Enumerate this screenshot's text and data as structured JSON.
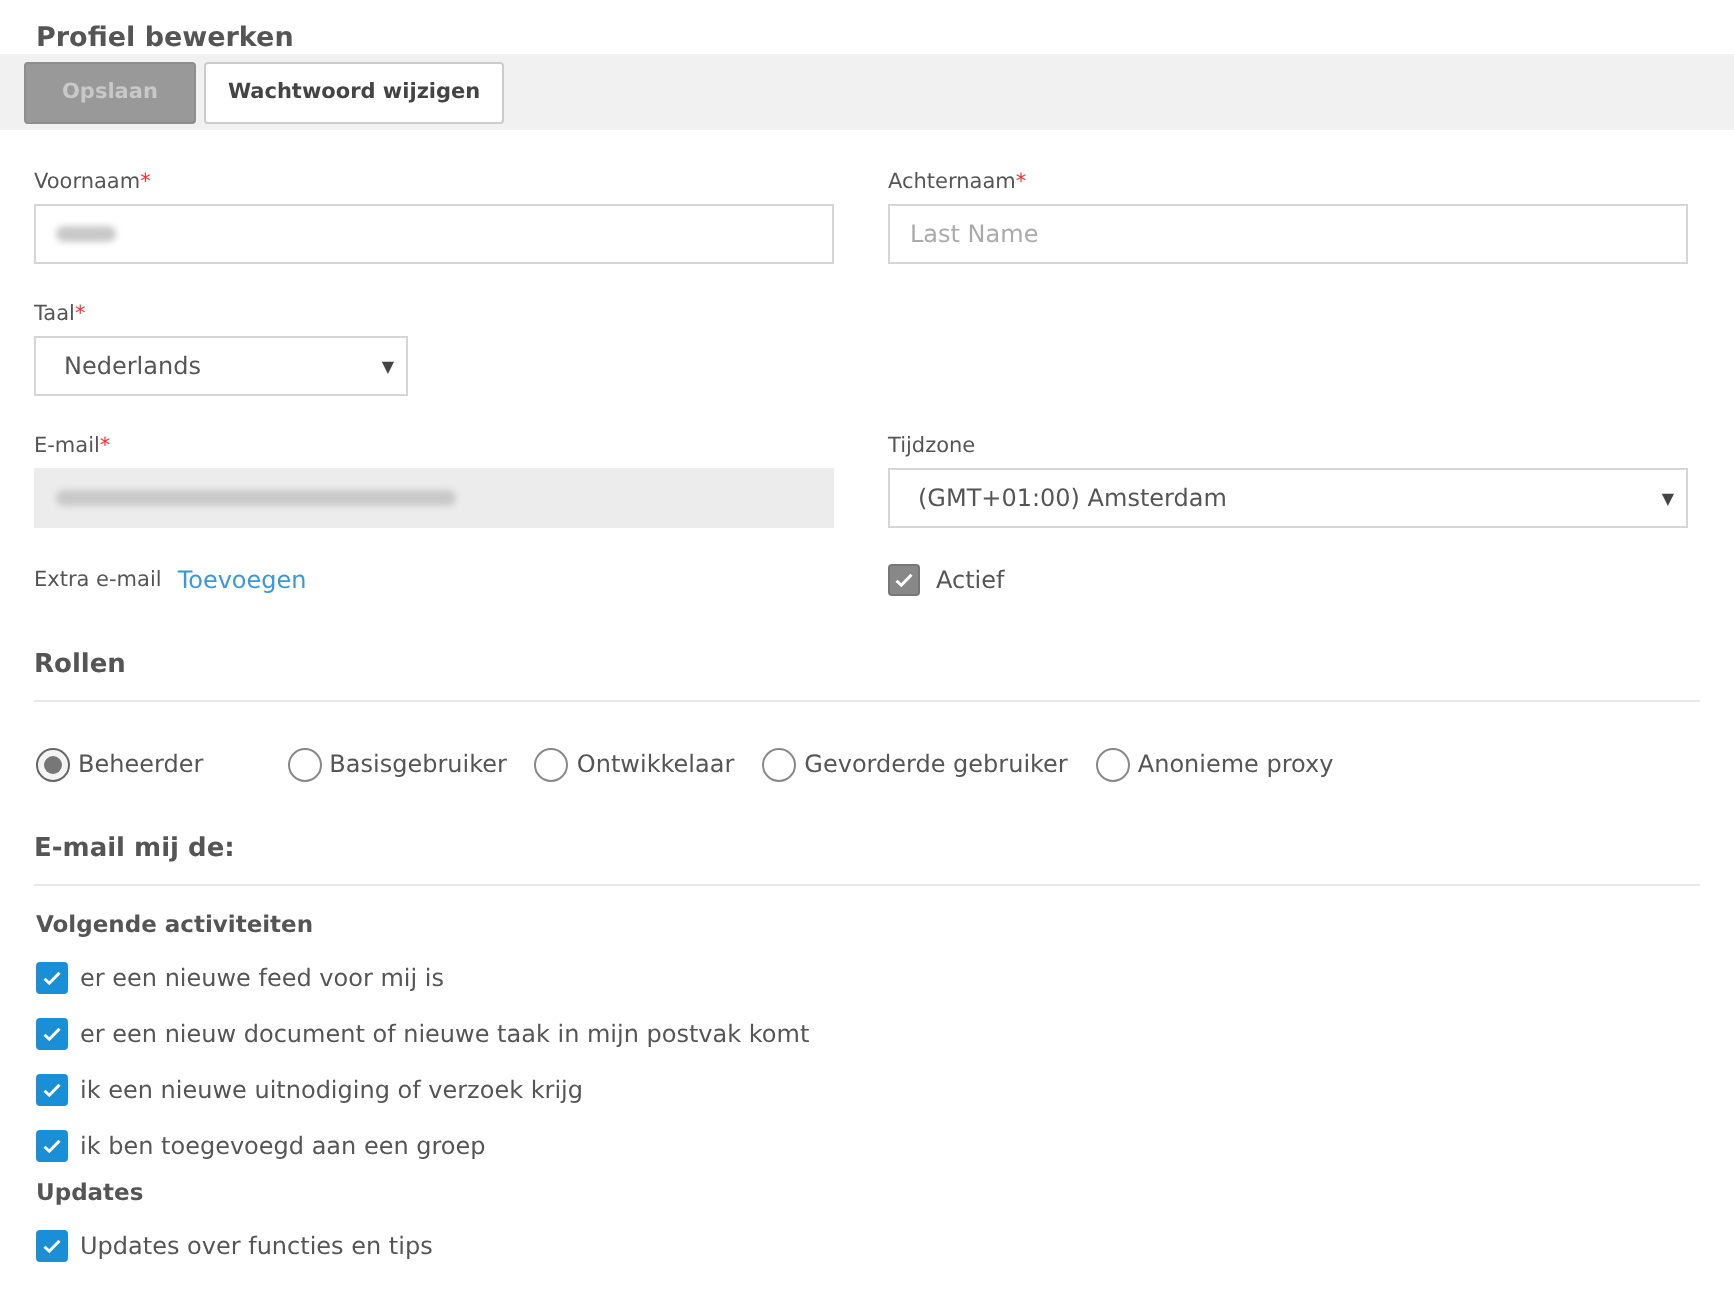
{
  "title": "Profiel bewerken",
  "toolbar": [
    {
      "label": "Opslaan",
      "disabled": true
    },
    {
      "label": "Wachtwoord wijzigen",
      "disabled": false
    }
  ],
  "first_name": {
    "label": "Voornaam",
    "required_mark": "*",
    "value_redacted": true
  },
  "last_name": {
    "label": "Achternaam",
    "required_mark": "*",
    "placeholder": "Last Name"
  },
  "language": {
    "label": "Taal",
    "required_mark": "*",
    "value": "Nederlands",
    "caret": "▼"
  },
  "email": {
    "label": "E-mail",
    "required_mark": "*",
    "value_redacted": true,
    "disabled": true
  },
  "timezone": {
    "label": "Tijdzone",
    "value": "(GMT+01:00) Amsterdam",
    "caret": "▼"
  },
  "extra_email": {
    "label": "Extra e-mail",
    "link": "Toevoegen"
  },
  "active": {
    "label": "Actief",
    "checked": true,
    "disabled": true
  },
  "roles": {
    "heading": "Rollen",
    "options": [
      {
        "label": "Beheerder",
        "selected": true
      },
      {
        "label": "Basisgebruiker",
        "selected": false
      },
      {
        "label": "Ontwikkelaar",
        "selected": false
      },
      {
        "label": "Gevorderde gebruiker",
        "selected": false
      },
      {
        "label": "Anonieme proxy",
        "selected": false
      }
    ]
  },
  "notifications": {
    "heading": "E-mail mij de:",
    "groups": [
      {
        "heading": "Volgende activiteiten",
        "items": [
          {
            "label": "er een nieuwe feed voor mij is",
            "checked": true
          },
          {
            "label": "er een nieuw document of nieuwe taak in mijn postvak komt",
            "checked": true
          },
          {
            "label": "ik een nieuwe uitnodiging of verzoek krijg",
            "checked": true
          },
          {
            "label": "ik ben toegevoegd aan een groep",
            "checked": true
          }
        ]
      },
      {
        "heading": "Updates",
        "items": [
          {
            "label": "Updates over functies en tips",
            "checked": true
          }
        ]
      }
    ]
  }
}
